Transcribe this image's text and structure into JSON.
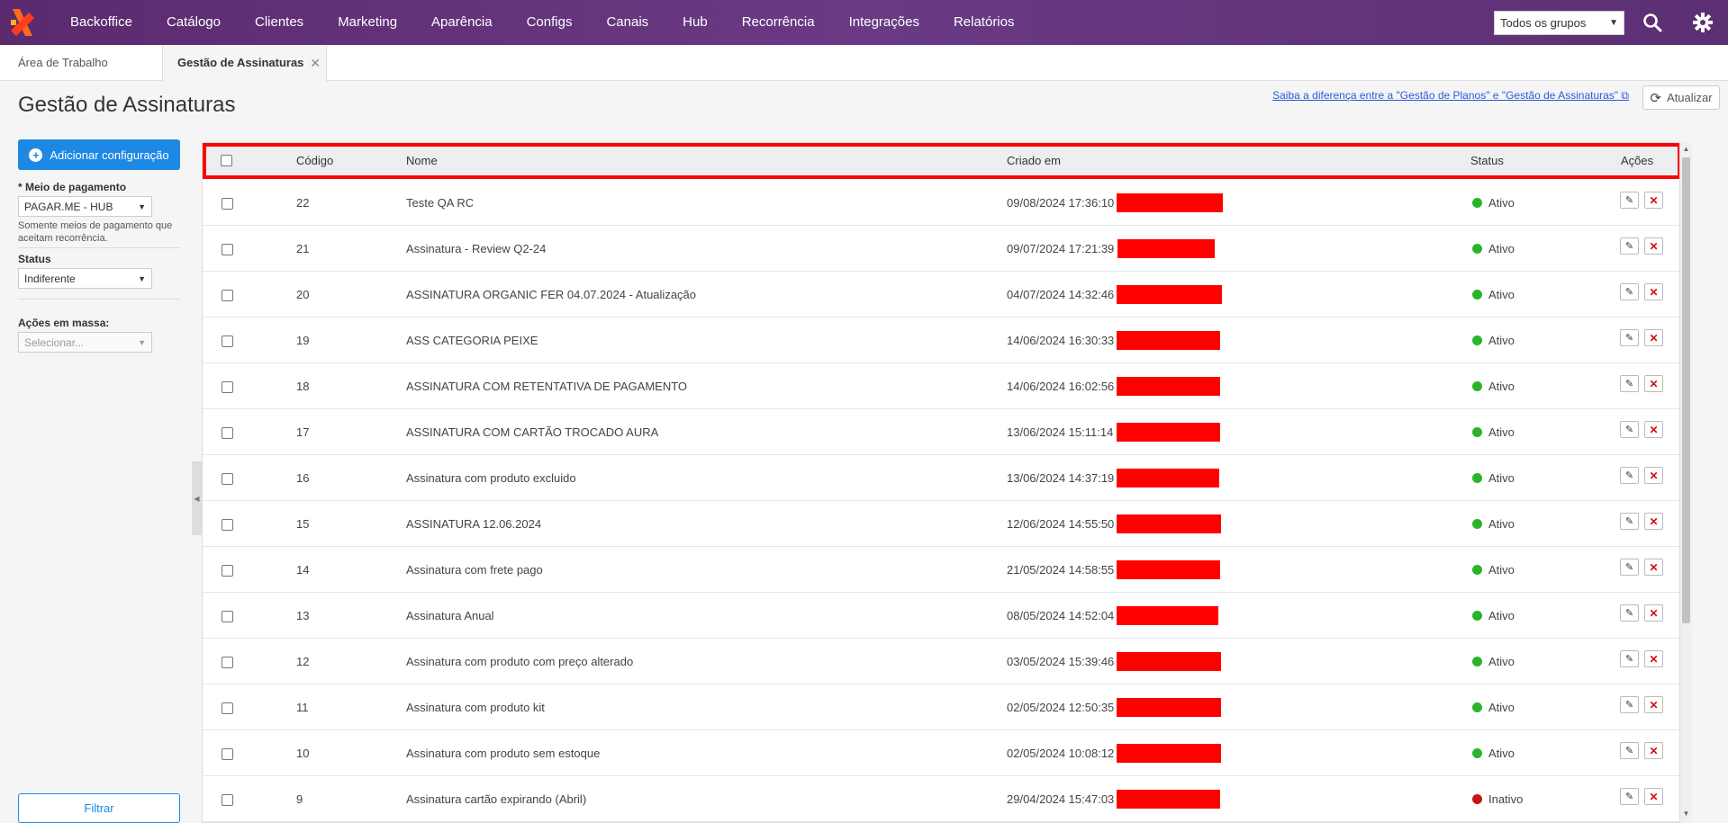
{
  "nav": {
    "items": [
      "Backoffice",
      "Catálogo",
      "Clientes",
      "Marketing",
      "Aparência",
      "Configs",
      "Canais",
      "Hub",
      "Recorrência",
      "Integrações",
      "Relatórios"
    ],
    "group_select": "Todos os grupos"
  },
  "tabs": [
    {
      "label": "Área de Trabalho"
    },
    {
      "label": "Gestão de Assinaturas"
    }
  ],
  "page": {
    "title": "Gestão de Assinaturas",
    "help_link": "Saiba a diferença entre a \"Gestão de Planos\" e \"Gestão de Assinaturas\"",
    "refresh_label": "Atualizar"
  },
  "sidebar": {
    "add_button": "Adicionar configuração",
    "payment_label": "* Meio de pagamento",
    "payment_value": "PAGAR.ME - HUB",
    "payment_help": "Somente meios de pagamento que aceitam recorrência.",
    "status_label": "Status",
    "status_value": "Indiferente",
    "bulk_label": "Ações em massa:",
    "bulk_placeholder": "Selecionar...",
    "filter_button": "Filtrar"
  },
  "table": {
    "headers": {
      "code": "Código",
      "name": "Nome",
      "created": "Criado em",
      "status": "Status",
      "actions": "Ações"
    },
    "rows": [
      {
        "code": "22",
        "name": "Teste QA RC",
        "created": "09/08/2024 17:36:10 -",
        "status": "Ativo"
      },
      {
        "code": "21",
        "name": "Assinatura - Review Q2-24",
        "created": "09/07/2024 17:21:39 -",
        "status": "Ativo"
      },
      {
        "code": "20",
        "name": "ASSINATURA ORGANIC FER 04.07.2024 - Atualização",
        "created": "04/07/2024 14:32:46 -",
        "status": "Ativo"
      },
      {
        "code": "19",
        "name": "ASS CATEGORIA PEIXE",
        "created": "14/06/2024 16:30:33 -",
        "status": "Ativo"
      },
      {
        "code": "18",
        "name": "ASSINATURA COM RETENTATIVA DE PAGAMENTO",
        "created": "14/06/2024 16:02:56 -",
        "status": "Ativo"
      },
      {
        "code": "17",
        "name": "ASSINATURA COM CARTÃO TROCADO AURA",
        "created": "13/06/2024 15:11:14 -",
        "status": "Ativo"
      },
      {
        "code": "16",
        "name": "Assinatura com produto excluido",
        "created": "13/06/2024 14:37:19 -",
        "status": "Ativo"
      },
      {
        "code": "15",
        "name": "ASSINATURA 12.06.2024",
        "created": "12/06/2024 14:55:50 -",
        "status": "Ativo"
      },
      {
        "code": "14",
        "name": "Assinatura com frete pago",
        "created": "21/05/2024 14:58:55 -",
        "status": "Ativo"
      },
      {
        "code": "13",
        "name": "Assinatura Anual",
        "created": "08/05/2024 14:52:04 -",
        "status": "Ativo"
      },
      {
        "code": "12",
        "name": "Assinatura com produto com preço alterado",
        "created": "03/05/2024 15:39:46 -",
        "status": "Ativo"
      },
      {
        "code": "11",
        "name": "Assinatura com produto kit",
        "created": "02/05/2024 12:50:35 -",
        "status": "Ativo"
      },
      {
        "code": "10",
        "name": "Assinatura com produto sem estoque",
        "created": "02/05/2024 10:08:12 -",
        "status": "Ativo"
      },
      {
        "code": "9",
        "name": "Assinatura cartão expirando (Abril)",
        "created": "29/04/2024 15:47:03 -",
        "status": "Inativo"
      }
    ]
  },
  "colors": {
    "nav_bg": "#5b2a6e",
    "primary": "#1e88e5",
    "active": "#2bb32b",
    "inactive": "#c41616",
    "highlight": "#ff0000"
  }
}
